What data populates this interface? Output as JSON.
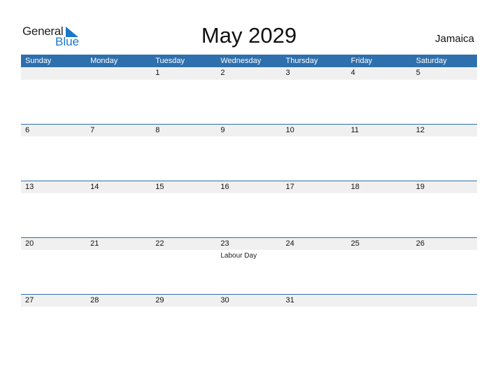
{
  "logo": {
    "word1": "General",
    "word2": "Blue"
  },
  "title": "May 2029",
  "country": "Jamaica",
  "weekdays": [
    "Sunday",
    "Monday",
    "Tuesday",
    "Wednesday",
    "Thursday",
    "Friday",
    "Saturday"
  ],
  "weeks": [
    {
      "days": [
        "",
        "",
        "1",
        "2",
        "3",
        "4",
        "5"
      ],
      "holidays": [
        "",
        "",
        "",
        "",
        "",
        "",
        ""
      ]
    },
    {
      "days": [
        "6",
        "7",
        "8",
        "9",
        "10",
        "11",
        "12"
      ],
      "holidays": [
        "",
        "",
        "",
        "",
        "",
        "",
        ""
      ]
    },
    {
      "days": [
        "13",
        "14",
        "15",
        "16",
        "17",
        "18",
        "19"
      ],
      "holidays": [
        "",
        "",
        "",
        "",
        "",
        "",
        ""
      ]
    },
    {
      "days": [
        "20",
        "21",
        "22",
        "23",
        "24",
        "25",
        "26"
      ],
      "holidays": [
        "",
        "",
        "",
        "Labour Day",
        "",
        "",
        ""
      ]
    },
    {
      "days": [
        "27",
        "28",
        "29",
        "30",
        "31",
        "",
        ""
      ],
      "holidays": [
        "",
        "",
        "",
        "",
        "",
        "",
        ""
      ]
    }
  ],
  "colors": {
    "header": "#2e6fad",
    "accent": "#1a77c9"
  }
}
